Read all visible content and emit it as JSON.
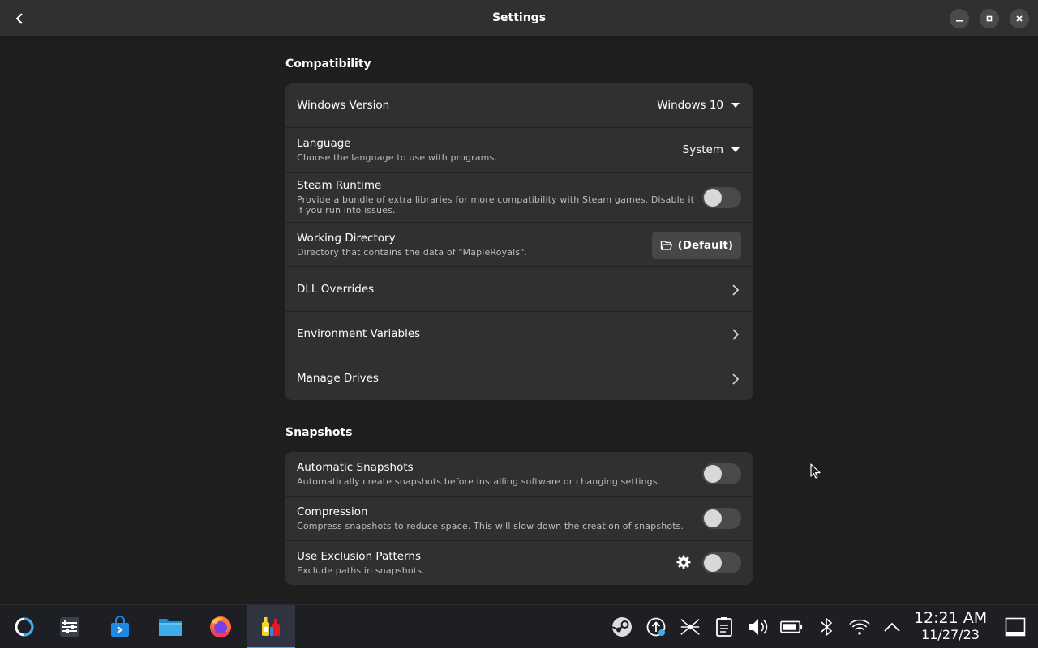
{
  "window": {
    "title": "Settings"
  },
  "compatibility": {
    "section_title": "Compatibility",
    "windows_version": {
      "label": "Windows Version",
      "value": "Windows 10"
    },
    "language": {
      "label": "Language",
      "description": "Choose the language to use with programs.",
      "value": "System"
    },
    "steam_runtime": {
      "label": "Steam Runtime",
      "description": "Provide a bundle of extra libraries for more compatibility with Steam games. Disable it if you run into issues.",
      "enabled": false
    },
    "working_directory": {
      "label": "Working Directory",
      "description": "Directory that contains the data of \"MapleRoyals\".",
      "button_label": "(Default)"
    },
    "dll_overrides": {
      "label": "DLL Overrides"
    },
    "environment_variables": {
      "label": "Environment Variables"
    },
    "manage_drives": {
      "label": "Manage Drives"
    }
  },
  "snapshots": {
    "section_title": "Snapshots",
    "automatic": {
      "label": "Automatic Snapshots",
      "description": "Automatically create snapshots before installing software or changing settings.",
      "enabled": false
    },
    "compression": {
      "label": "Compression",
      "description": "Compress snapshots to reduce space. This will slow down the creation of snapshots.",
      "enabled": false
    },
    "exclusion": {
      "label": "Use Exclusion Patterns",
      "description": "Exclude paths in snapshots.",
      "enabled": false
    }
  },
  "taskbar": {
    "apps": [
      "steam-deck-menu-icon",
      "system-settings-icon",
      "discover-store-icon",
      "file-manager-icon",
      "firefox-icon",
      "bottles-icon"
    ],
    "active_app": "bottles-icon",
    "tray": [
      "steam-icon",
      "update-icon",
      "network-hub-icon",
      "clipboard-icon",
      "volume-icon",
      "battery-icon",
      "bluetooth-icon",
      "wifi-icon",
      "expand-tray-icon"
    ],
    "time": "12:21 AM",
    "date": "11/27/23"
  },
  "colors": {
    "background": "#1e1e1e",
    "card": "#303030",
    "toggle_off": "#4a4a4a",
    "taskbar": "#1d1f24",
    "accent": "#3daee9"
  }
}
